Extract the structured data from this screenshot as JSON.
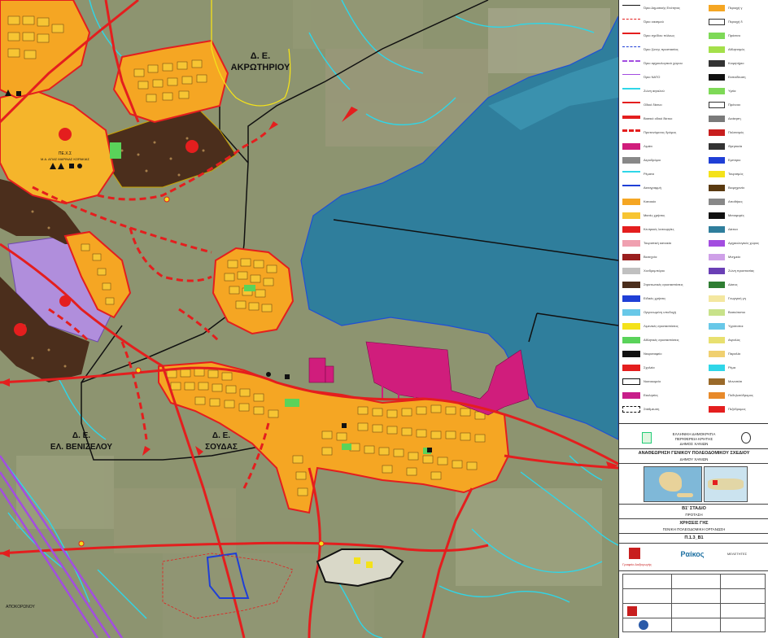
{
  "map": {
    "labels": {
      "akrotiri_1": "Δ. Ε.",
      "akrotiri_2": "ΑΚΡΩΤΗΡΙΟΥ",
      "venizelou_1": "Δ. Ε.",
      "venizelou_2": "ΕΛ. ΒΕΝΙΖΕΛΟΥ",
      "soudas_1": "Δ. Ε.",
      "soudas_2": "ΣΟΥΔΑΣ"
    },
    "colors": {
      "background": "#8a8f6c",
      "sea": "#2f7e9c",
      "settlement_fill": "#f5a623",
      "settlement_block": "#f7c533",
      "road_red": "#e41e1e",
      "industrial": "#4b2e1c",
      "purple_zone": "#b48ee8",
      "port": "#d01d7c",
      "stream": "#2fd6e8",
      "boundary": "#111111"
    },
    "small_labels": {
      "zone_label": "ΠΕ.Χ.Σ",
      "zone_sub": "Μ.Α. ΑΓΙΑΣ ΜΑΡΙΝΑΣ ΚΟΡΑΚΙΑΣ",
      "bottom_left": "ΑΠΟΚΟΡΩΝΟΥ"
    }
  },
  "legend": {
    "rows": [
      {
        "left": "Όριο Δημοτικής Ενότητας",
        "right": "Περιοχή γ"
      },
      {
        "left": "Όριο οικισμού",
        "right": "Περιοχή δ"
      },
      {
        "left": "Όριο σχεδίου πόλεως",
        "right": "Πράσινο"
      },
      {
        "left": "Όριο ζώνης προστασίας",
        "right": "Αθλητισμός"
      },
      {
        "left": "Όριο αρχαιολογικού χώρου",
        "right": "Κοιμητήριο"
      },
      {
        "left": "Όριο ΝΑΤΟ",
        "right": "Εκπαίδευση"
      },
      {
        "left": "Ζώνη αιγιαλού",
        "right": "Υγεία"
      },
      {
        "left": "Οδικό δίκτυο",
        "right": "Πρόνοια"
      },
      {
        "left": "Βασικό οδικό δίκτυο",
        "right": "Διοίκηση"
      },
      {
        "left": "Προτεινόμενος δρόμος",
        "right": "Πολιτισμός"
      },
      {
        "left": "Λιμάνι",
        "right": "Θρησκεία"
      },
      {
        "left": "Αεροδρόμιο",
        "right": "Εμπόριο"
      },
      {
        "left": "Ρέματα",
        "right": "Τουρισμός"
      },
      {
        "left": "Ακτογραμμή",
        "right": "Βιομηχανία"
      },
      {
        "left": "Κατοικία",
        "right": "Αποθήκες"
      },
      {
        "left": "Μικτές χρήσεις",
        "right": "Μεταφορές"
      },
      {
        "left": "Κεντρικές λειτουργίες",
        "right": "Δίκτυα"
      },
      {
        "left": "Τουριστική κατοικία",
        "right": "Αρχαιολογικός χώρος"
      },
      {
        "left": "Βιοτεχνία",
        "right": "Μνημεία"
      },
      {
        "left": "Χονδρεμπόριο",
        "right": "Ζώνη προστασίας"
      },
      {
        "left": "Στρατιωτικές εγκαταστάσεις",
        "right": "Δάσος"
      },
      {
        "left": "Ειδικές χρήσεις",
        "right": "Γεωργική γη"
      },
      {
        "left": "Οργανωμένη υποδοχή",
        "right": "Βοσκότοποι"
      },
      {
        "left": "Λιμενικές εγκαταστάσεις",
        "right": "Υγρότοποι"
      },
      {
        "left": "Αθλητικές εγκαταστάσεις",
        "right": "Αιγιαλός"
      },
      {
        "left": "Νεκροταφείο",
        "right": "Παραλία"
      },
      {
        "left": "Σχολεία",
        "right": "Ρέμα"
      },
      {
        "left": "Νοσοκομείο",
        "right": "Μονοπάτι"
      },
      {
        "left": "Εκκλησίες",
        "right": "Ποδηλατόδρομος"
      },
      {
        "left": "Στάθμευση",
        "right": "Πεζόδρομος"
      }
    ]
  },
  "titleblock": {
    "header_1": "ΕΛΛΗΝΙΚΗ ΔΗΜΟΚΡΑΤΙΑ",
    "header_2": "ΠΕΡΙΦΕΡΕΙΑ ΚΡΗΤΗΣ",
    "header_3": "ΔΗΜΟΣ ΧΑΝΙΩΝ",
    "study_title": "ΑΝΑΘΕΩΡΗΣΗ ΓΕΝΙΚΟΥ ΠΟΛΕΟΔΟΜΙΚΟΥ ΣΧΕΔΙΟΥ",
    "study_sub": "ΔΗΜΟΥ ΧΑΝΙΩΝ",
    "stage": "Β1' ΣΤΑΔΙΟ",
    "stage_sub": "ΠΡΟΤΑΣΗ",
    "map_title": "ΧΡΗΣΕΙΣ ΓΗΣ",
    "map_sub": "ΓΕΝΙΚΗ ΠΟΛΕΟΔΟΜΙΚΗ ΟΡΓΑΝΩΣΗ",
    "map_no": "Π.1.3_Β1",
    "company": "Ραίκος",
    "company_sub": "ΜΕΛΕΤΗΤΕΣ",
    "brand": "Γραφείο Διεξαγωγής"
  }
}
